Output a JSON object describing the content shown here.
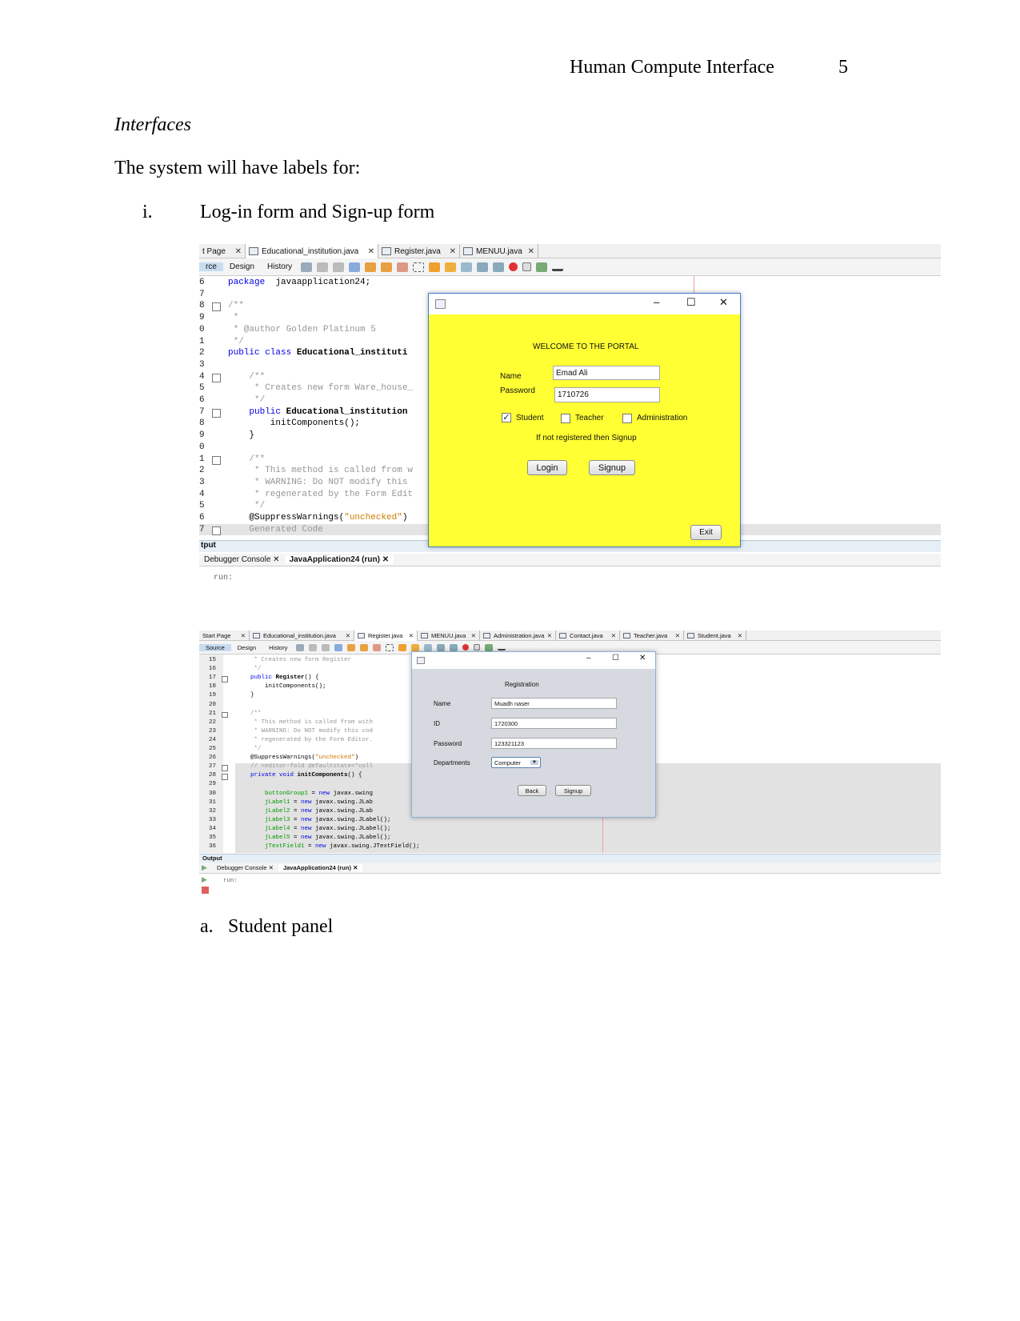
{
  "header": {
    "running_title": "Human Compute Interface",
    "page_number": "5"
  },
  "section_heading": "Interfaces",
  "intro": "The system will have labels for:",
  "list_item": {
    "marker": "i.",
    "text": "Log-in form and Sign-up form"
  },
  "sub_item": {
    "marker": "a.",
    "text": "Student panel"
  },
  "screenshot1": {
    "tabs": [
      {
        "label": "t Page"
      },
      {
        "label": "Educational_institution.java"
      },
      {
        "label": "Register.java"
      },
      {
        "label": "MENUU.java"
      }
    ],
    "toolbar": {
      "source": "rce",
      "design": "Design",
      "history": "History"
    },
    "line_numbers": [
      "6",
      "7",
      "8",
      "9",
      "0",
      "1",
      "2",
      "3",
      "4",
      "5",
      "6",
      "7",
      "8",
      "9",
      "0",
      "1",
      "2",
      "3",
      "4",
      "5",
      "6",
      "7"
    ],
    "code": [
      [
        [
          "kw",
          "package"
        ],
        [
          "",
          "  javaapplication24;"
        ]
      ],
      [],
      [
        [
          "cm",
          "/**"
        ]
      ],
      [
        [
          "cm",
          " *"
        ]
      ],
      [
        [
          "cm",
          " * @author Golden Platinum 5"
        ]
      ],
      [
        [
          "cm",
          " */"
        ]
      ],
      [
        [
          "kw",
          "public class"
        ],
        [
          "bold",
          " Educational_instituti"
        ]
      ],
      [],
      [
        [
          "cm",
          "    /**"
        ]
      ],
      [
        [
          "cm",
          "     * Creates new form Ware_house_"
        ]
      ],
      [
        [
          "cm",
          "     */"
        ]
      ],
      [
        [
          "kw",
          "    public"
        ],
        [
          "bold",
          " Educational_institution"
        ]
      ],
      [
        [
          "",
          "        initComponents();"
        ]
      ],
      [
        [
          "",
          "    }"
        ]
      ],
      [],
      [
        [
          "cm",
          "    /**"
        ]
      ],
      [
        [
          "cm",
          "     * This method is called from w"
        ]
      ],
      [
        [
          "cm",
          "     * WARNING: Do NOT modify this"
        ]
      ],
      [
        [
          "cm",
          "     * regenerated by the Form Edit"
        ]
      ],
      [
        [
          "cm",
          "     */"
        ]
      ],
      [
        [
          "",
          "    @SuppressWarnings("
        ],
        [
          "st",
          "\"unchecked\""
        ],
        [
          "",
          ")"
        ]
      ],
      [
        [
          "cm",
          "    Generated Code"
        ]
      ]
    ],
    "output": {
      "title": "tput",
      "tabs": [
        "Debugger Console",
        "JavaApplication24 (run)"
      ],
      "text": "run:"
    },
    "login_window": {
      "welcome": "WELCOME TO THE PORTAL",
      "name_label": "Name",
      "name_value": "Emad Ali",
      "password_label": "Password",
      "password_value": "1710726",
      "checkboxes": [
        {
          "label": "Student",
          "checked": true
        },
        {
          "label": "Teacher",
          "checked": false
        },
        {
          "label": "Administration",
          "checked": false
        }
      ],
      "hint": "If not registered then Signup",
      "login_button": "Login",
      "signup_button": "Signup",
      "exit_button": "Exit",
      "background": "#ffff33"
    }
  },
  "screenshot2": {
    "tabs": [
      {
        "label": "Start Page"
      },
      {
        "label": "Educational_institution.java"
      },
      {
        "label": "Register.java"
      },
      {
        "label": "MENUU.java"
      },
      {
        "label": "Administration.java"
      },
      {
        "label": "Contact.java"
      },
      {
        "label": "Teacher.java"
      },
      {
        "label": "Student.java"
      }
    ],
    "toolbar": {
      "source": "Source",
      "design": "Design",
      "history": "History"
    },
    "line_numbers": [
      "15",
      "16",
      "17",
      "18",
      "19",
      "20",
      "21",
      "22",
      "23",
      "24",
      "25",
      "26",
      "27",
      "28",
      "29",
      "30",
      "31",
      "32",
      "33",
      "34",
      "35",
      "36"
    ],
    "code": [
      [
        [
          "cm",
          "     * Creates new form Register"
        ]
      ],
      [
        [
          "cm",
          "     */"
        ]
      ],
      [
        [
          "kw",
          "    public"
        ],
        [
          "bold",
          " Register"
        ],
        [
          "",
          "() {"
        ]
      ],
      [
        [
          "",
          "        initComponents();"
        ]
      ],
      [
        [
          "",
          "    }"
        ]
      ],
      [],
      [
        [
          "cm",
          "    /**"
        ]
      ],
      [
        [
          "cm",
          "     * This method is called from with"
        ]
      ],
      [
        [
          "cm",
          "     * WARNING: Do NOT modify this cod"
        ]
      ],
      [
        [
          "cm",
          "     * regenerated by the Form Editor."
        ]
      ],
      [
        [
          "cm",
          "     */"
        ]
      ],
      [
        [
          "",
          "    @SuppressWarnings("
        ],
        [
          "st",
          "\"unchecked\""
        ],
        [
          "",
          ")"
        ]
      ],
      [
        [
          "cm",
          "    // <editor-fold defaultstate=\"coll"
        ]
      ],
      [
        [
          "kw",
          "    private void"
        ],
        [
          "bold",
          " initComponents"
        ],
        [
          "",
          "() {"
        ]
      ],
      [],
      [
        [
          "gr",
          "        buttonGroup1"
        ],
        [
          "",
          " = "
        ],
        [
          "kw",
          "new"
        ],
        [
          "",
          " javax.swing"
        ]
      ],
      [
        [
          "gr",
          "        jLabel1"
        ],
        [
          "",
          " = "
        ],
        [
          "kw",
          "new"
        ],
        [
          "",
          " javax.swing.JLab"
        ]
      ],
      [
        [
          "gr",
          "        jLabel2"
        ],
        [
          "",
          " = "
        ],
        [
          "kw",
          "new"
        ],
        [
          "",
          " javax.swing.JLab"
        ]
      ],
      [
        [
          "gr",
          "        jLabel3"
        ],
        [
          "",
          " = "
        ],
        [
          "kw",
          "new"
        ],
        [
          "",
          " javax.swing.JLabel();"
        ]
      ],
      [
        [
          "gr",
          "        jLabel4"
        ],
        [
          "",
          " = "
        ],
        [
          "kw",
          "new"
        ],
        [
          "",
          " javax.swing.JLabel();"
        ]
      ],
      [
        [
          "gr",
          "        jLabel5"
        ],
        [
          "",
          " = "
        ],
        [
          "kw",
          "new"
        ],
        [
          "",
          " javax.swing.JLabel();"
        ]
      ],
      [
        [
          "gr",
          "        jTextField1"
        ],
        [
          "",
          " = "
        ],
        [
          "kw",
          "new"
        ],
        [
          "",
          " javax.swing.JTextField();"
        ]
      ]
    ],
    "output": {
      "title": "Output",
      "tabs": [
        "Debugger Console",
        "JavaApplication24 (run)"
      ],
      "text": "run:"
    },
    "register_window": {
      "title": "Registration",
      "name_label": "Name",
      "name_value": "Muadh naser",
      "id_label": "ID",
      "id_value": "1720300",
      "password_label": "Password",
      "password_value": "123321123",
      "departments_label": "Departments",
      "departments_value": "Computer",
      "back_button": "Back",
      "signup_button": "Signup"
    }
  }
}
